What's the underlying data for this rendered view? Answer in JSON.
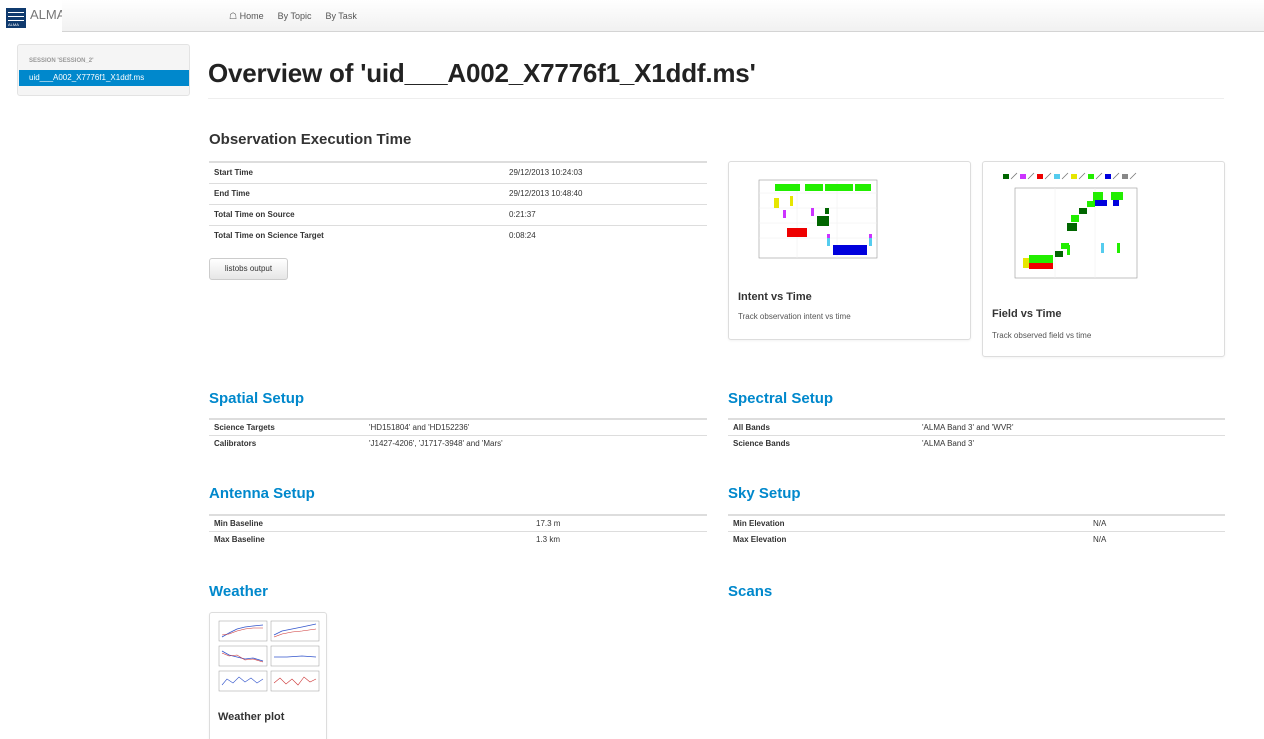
{
  "app": {
    "brand": "ALMA",
    "logo_text": "ALMA"
  },
  "nav": {
    "items": [
      "Home",
      "By Topic",
      "By Task"
    ]
  },
  "sidebar": {
    "session_header": "SESSION 'SESSION_2'",
    "items": [
      "uid___A002_X7776f1_X1ddf.ms"
    ]
  },
  "page": {
    "title": "Overview of 'uid___A002_X7776f1_X1ddf.ms'"
  },
  "execution_time": {
    "heading": "Observation Execution Time",
    "rows": [
      {
        "label": "Start Time",
        "value": "29/12/2013 10:24:03"
      },
      {
        "label": "End Time",
        "value": "29/12/2013 10:48:40"
      },
      {
        "label": "Total Time on Source",
        "value": "0:21:37"
      },
      {
        "label": "Total Time on Science Target",
        "value": "0:08:24"
      }
    ],
    "button_label": "listobs output"
  },
  "thumbnails": {
    "intent": {
      "title": "Intent vs Time",
      "text": "Track observation intent vs time"
    },
    "field": {
      "title": "Field vs Time",
      "text": "Track observed field vs time"
    },
    "weather": {
      "title": "Weather plot"
    }
  },
  "spatial": {
    "heading": "Spatial Setup",
    "rows": [
      {
        "label": "Science Targets",
        "value": "'HD151804' and 'HD152236'"
      },
      {
        "label": "Calibrators",
        "value": "'J1427-4206', 'J1717-3948' and 'Mars'"
      }
    ]
  },
  "spectral": {
    "heading": "Spectral Setup",
    "rows": [
      {
        "label": "All Bands",
        "value": "'ALMA Band 3' and 'WVR'"
      },
      {
        "label": "Science Bands",
        "value": "'ALMA Band 3'"
      }
    ]
  },
  "antenna": {
    "heading": "Antenna Setup",
    "rows": [
      {
        "label": "Min Baseline",
        "value": "17.3 m"
      },
      {
        "label": "Max Baseline",
        "value": "1.3 km"
      }
    ]
  },
  "sky": {
    "heading": "Sky Setup",
    "rows": [
      {
        "label": "Min Elevation",
        "value": "N/A"
      },
      {
        "label": "Max Elevation",
        "value": "N/A"
      }
    ]
  },
  "weather": {
    "heading": "Weather"
  },
  "scans": {
    "heading": "Scans"
  },
  "colors": {
    "link": "#0088cc",
    "active": "#0088cc",
    "green": "#22ee00",
    "blue": "#0000dd",
    "red": "#ee0000"
  }
}
